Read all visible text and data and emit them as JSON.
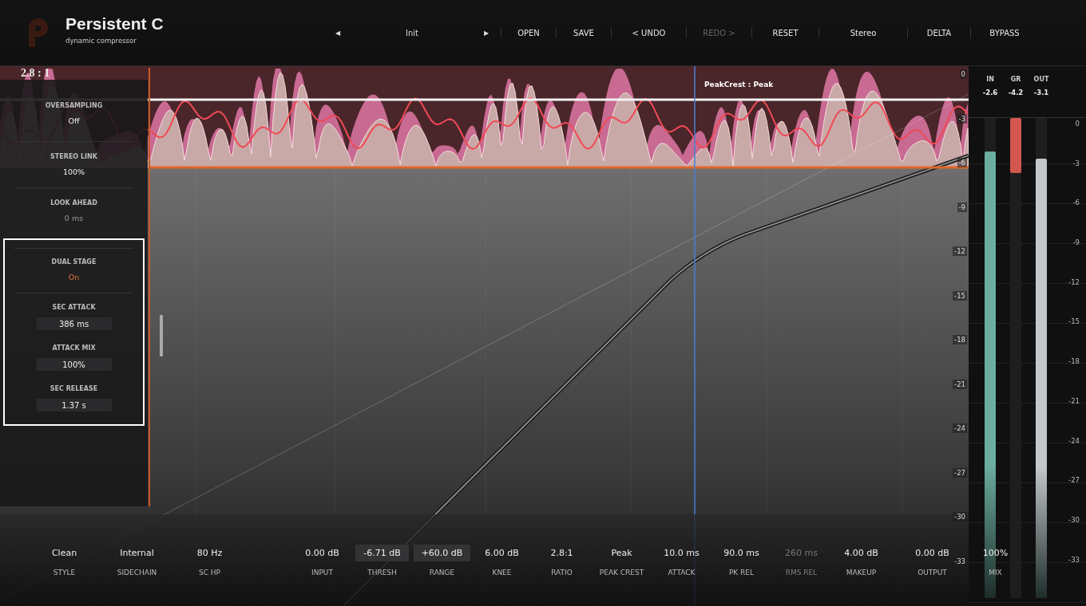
{
  "header": {
    "title": "Persistent C",
    "subtitle": "dynamic compressor",
    "preset": {
      "prev": "◀",
      "name": "Init",
      "next": "▶"
    },
    "buttons": [
      {
        "label": "OPEN",
        "disabled": false
      },
      {
        "label": "SAVE",
        "disabled": false
      },
      {
        "label": "< UNDO",
        "disabled": false
      },
      {
        "label": "REDO >",
        "disabled": true
      },
      {
        "label": "RESET",
        "disabled": false
      },
      {
        "label": "Stereo",
        "disabled": false
      },
      {
        "label": "DELTA",
        "disabled": false
      },
      {
        "label": "BYPASS",
        "disabled": false
      }
    ]
  },
  "graph": {
    "ratio_readout": "2.8 : 1",
    "mode_label": "PeakCrest : Peak",
    "axis_labels": [
      "0",
      "-3",
      "-6",
      "-9",
      "-12",
      "-15",
      "-18",
      "-21",
      "-24",
      "-27",
      "-30",
      "-33"
    ]
  },
  "side_panel": {
    "sections": [
      {
        "highlighted": false,
        "settings": [
          {
            "kind": "value",
            "label": "OVERSAMPLING",
            "value": "Off",
            "disabled": false
          },
          {
            "kind": "value",
            "label": "STEREO LINK",
            "value": "100%",
            "disabled": false
          },
          {
            "kind": "value",
            "label": "LOOK AHEAD",
            "value": "0 ms",
            "disabled": true
          }
        ]
      },
      {
        "highlighted": true,
        "settings": [
          {
            "kind": "toggle",
            "label": "DUAL STAGE",
            "value": "On",
            "on": true,
            "disabled": false
          },
          {
            "kind": "field",
            "label": "SEC ATTACK",
            "value": "386 ms",
            "disabled": false
          },
          {
            "kind": "field",
            "label": "ATTACK MIX",
            "value": "100%",
            "disabled": false
          },
          {
            "kind": "field",
            "label": "SEC RELEASE",
            "value": "1.37 s",
            "disabled": false
          }
        ]
      }
    ]
  },
  "controls": {
    "groups": [
      {
        "items": [
          {
            "value": "Clean",
            "label": "STYLE",
            "boxed": false,
            "disabled": false
          },
          {
            "value": "Internal",
            "label": "SIDECHAIN",
            "boxed": false,
            "disabled": false
          },
          {
            "value": "80 Hz",
            "label": "SC HP",
            "boxed": false,
            "disabled": false
          }
        ]
      },
      {
        "items": [
          {
            "value": "0.00 dB",
            "label": "INPUT",
            "boxed": false,
            "disabled": false
          },
          {
            "value": "-6.71 dB",
            "label": "THRESH",
            "boxed": true,
            "disabled": false
          },
          {
            "value": "+60.0 dB",
            "label": "RANGE",
            "boxed": true,
            "disabled": false
          },
          {
            "value": "6.00 dB",
            "label": "KNEE",
            "boxed": false,
            "disabled": false
          },
          {
            "value": "2.8:1",
            "label": "RATIO",
            "boxed": false,
            "disabled": false
          },
          {
            "value": "Peak",
            "label": "PEAK CREST",
            "boxed": false,
            "disabled": false
          },
          {
            "value": "10.0 ms",
            "label": "ATTACK",
            "boxed": false,
            "disabled": false
          },
          {
            "value": "90.0 ms",
            "label": "PK REL",
            "boxed": false,
            "disabled": false
          },
          {
            "value": "260 ms",
            "label": "RMS REL",
            "boxed": false,
            "disabled": true
          },
          {
            "value": "4.00 dB",
            "label": "MAKEUP",
            "boxed": false,
            "disabled": false
          }
        ]
      },
      {
        "items": [
          {
            "value": "0.00 dB",
            "label": "OUTPUT",
            "boxed": false,
            "disabled": false
          },
          {
            "value": "100%",
            "label": "MIX",
            "boxed": false,
            "disabled": false
          }
        ]
      }
    ]
  },
  "meters": [
    {
      "kind": "level",
      "label": "IN",
      "reading": "-2.6",
      "level": 0.93,
      "color": "#6cae9f"
    },
    {
      "kind": "reduction",
      "label": "GR",
      "reading": "-4.2",
      "level": 0.115,
      "color": "#d2574f"
    },
    {
      "kind": "level",
      "label": "OUT",
      "reading": "-3.1",
      "level": 0.915,
      "color": "#c4c7ca"
    }
  ],
  "meter_scale": [
    "0",
    "-3",
    "-6",
    "-9",
    "-12",
    "-15",
    "-18",
    "-21",
    "-24",
    "-27",
    "-30",
    "-33"
  ]
}
